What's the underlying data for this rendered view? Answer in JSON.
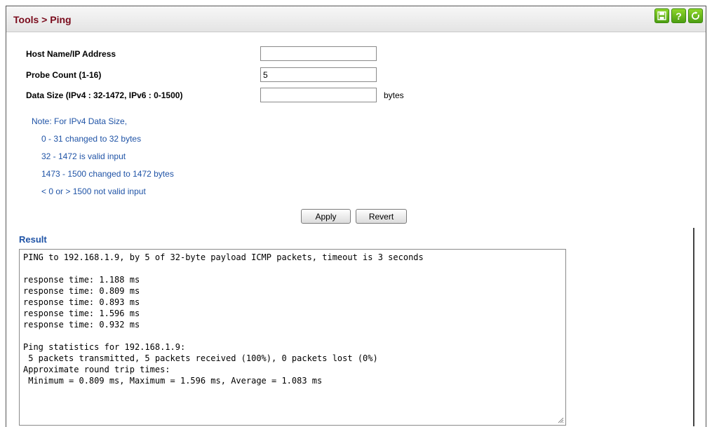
{
  "header": {
    "title": "Tools > Ping",
    "icons": [
      {
        "name": "save-icon",
        "glyph": "save"
      },
      {
        "name": "help-icon",
        "glyph": "?"
      },
      {
        "name": "refresh-icon",
        "glyph": "refresh"
      }
    ]
  },
  "form": {
    "host": {
      "label": "Host Name/IP Address",
      "value": ""
    },
    "probe": {
      "label": "Probe Count (1-16)",
      "value": "5"
    },
    "size": {
      "label": "Data Size (IPv4 : 32-1472, IPv6 : 0-1500)",
      "value": "",
      "unit": "bytes"
    }
  },
  "note": [
    "Note: For IPv4 Data Size,",
    "0 - 31 changed to 32 bytes",
    "32 - 1472 is valid input",
    "1473 - 1500 changed to 1472 bytes",
    "< 0 or > 1500 not valid input"
  ],
  "buttons": {
    "apply": "Apply",
    "revert": "Revert"
  },
  "result": {
    "label": "Result",
    "lines": [
      "PING to 192.168.1.9, by 5 of 32-byte payload ICMP packets, timeout is 3 seconds",
      "",
      "response time: 1.188 ms",
      "response time: 0.809 ms",
      "response time: 0.893 ms",
      "response time: 1.596 ms",
      "response time: 0.932 ms",
      "",
      "Ping statistics for 192.168.1.9:",
      " 5 packets transmitted, 5 packets received (100%), 0 packets lost (0%)",
      "Approximate round trip times:",
      " Minimum = 0.809 ms, Maximum = 1.596 ms, Average = 1.083 ms"
    ]
  },
  "colors": {
    "title": "#7a0b1c",
    "accent_blue": "#1f53a6",
    "icon_green": "#5aae17"
  }
}
